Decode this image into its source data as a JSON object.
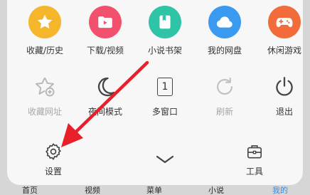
{
  "menu": {
    "row1": [
      {
        "label": "收藏/历史",
        "icon": "star-icon",
        "color": "#f5b62b"
      },
      {
        "label": "下载/视频",
        "icon": "video-folder-icon",
        "color": "#f2516d"
      },
      {
        "label": "小说书架",
        "icon": "book-icon",
        "color": "#2fc4a5"
      },
      {
        "label": "我的网盘",
        "icon": "cloud-icon",
        "color": "#3a9af0"
      },
      {
        "label": "休闲游戏",
        "icon": "gamepad-icon",
        "color": "#f26b3a"
      }
    ],
    "row2": [
      {
        "label": "收藏网址",
        "icon": "add-star-icon"
      },
      {
        "label": "夜间模式",
        "icon": "moon-icon"
      },
      {
        "label": "多窗口",
        "icon": "window-count-icon",
        "count": "1"
      },
      {
        "label": "刷新",
        "icon": "refresh-icon"
      },
      {
        "label": "退出",
        "icon": "power-icon"
      }
    ],
    "settings_label": "设置",
    "tools_label": "工具"
  },
  "bottom_nav": [
    "首页",
    "视频",
    "菜单",
    "小说",
    "我的"
  ],
  "annotation": {
    "arrow_color": "#e8202a"
  }
}
